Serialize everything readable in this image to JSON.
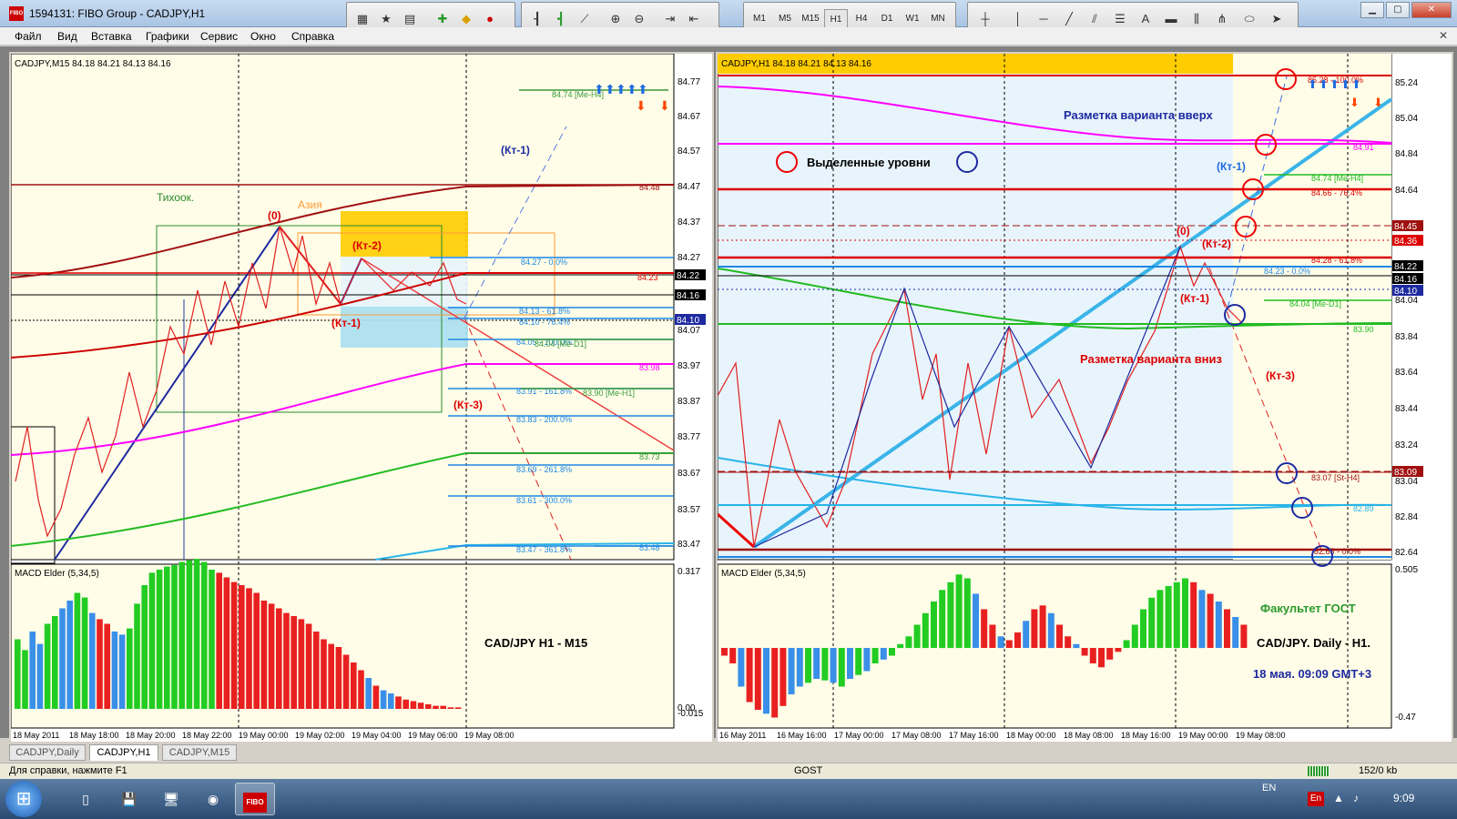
{
  "window": {
    "title": "1594131: FIBO Group - CADJPY,H1",
    "app_icon": "FIBO"
  },
  "toolbars": {
    "timeframes": [
      "M1",
      "M5",
      "M15",
      "H1",
      "H4",
      "D1",
      "W1",
      "MN"
    ],
    "selected_timeframe": "H1"
  },
  "menu": [
    "Файл",
    "Вид",
    "Вставка",
    "Графики",
    "Сервис",
    "Окно",
    "Справка"
  ],
  "left_chart": {
    "header": "CADJPY,M15  84.18 84.21 84.13 84.16",
    "indicator_header": "MACD Elder (5,34,5)",
    "overlay_title": "CAD/JPY H1 - M15",
    "price_axis": [
      "84.77",
      "84.67",
      "84.57",
      "84.47",
      "84.37",
      "84.27",
      "84.16",
      "84.07",
      "83.97",
      "83.87",
      "83.77",
      "83.67",
      "83.57",
      "83.47"
    ],
    "macd_axis": [
      "0.317",
      "0.00",
      "-0.015"
    ],
    "current_prices": [
      "84.22",
      "84.16",
      "84.10"
    ],
    "time_axis": [
      "18 May 2011",
      "18 May 18:00",
      "18 May 20:00",
      "18 May 22:00",
      "19 May 00:00",
      "19 May 02:00",
      "19 May 04:00",
      "19 May 06:00",
      "19 May 08:00"
    ],
    "labels": {
      "tokyo": "Тихоок.",
      "asia": "Азия",
      "k0": "(0)",
      "kt1_blue": "(Кт-1)",
      "kt1_red": "(Кт-1)",
      "kt2": "(Кт-2)",
      "kt3": "(Кт-3)"
    },
    "levels": [
      {
        "label": "84.74 [Me-H4]"
      },
      {
        "label": "84.48"
      },
      {
        "label": "84.27 - 0.0%"
      },
      {
        "label": "84.23"
      },
      {
        "label": "84.13 - 61.8%"
      },
      {
        "label": "84.10 - 76.4%"
      },
      {
        "label": "84.05 - 100.0%"
      },
      {
        "label": "84.04 [Me-D1]"
      },
      {
        "label": "83.98"
      },
      {
        "label": "83.91 - 161.8%"
      },
      {
        "label": "83.90 [Me-H1]"
      },
      {
        "label": "83.83 - 200.0%"
      },
      {
        "label": "83.73"
      },
      {
        "label": "83.69 - 261.8%"
      },
      {
        "label": "83.61 - 300.0%"
      },
      {
        "label": "83.47 - 361.8%"
      },
      {
        "label": "83.48"
      }
    ]
  },
  "right_chart": {
    "header": "CADJPY,H1  84.18 84.21 84.13 84.16",
    "indicator_header": "MACD Elder (5,34,5)",
    "price_axis": [
      "85.24",
      "85.04",
      "84.84",
      "84.64",
      "84.45",
      "84.36",
      "84.22",
      "84.16",
      "84.10",
      "84.04",
      "83.84",
      "83.64",
      "83.44",
      "83.24",
      "83.09",
      "83.04",
      "82.84",
      "82.64"
    ],
    "macd_axis": [
      "0.505",
      "-0.47"
    ],
    "time_axis": [
      "16 May 2011",
      "16 May 16:00",
      "17 May 00:00",
      "17 May 08:00",
      "17 May 16:00",
      "18 May 00:00",
      "18 May 08:00",
      "18 May 16:00",
      "19 May 00:00",
      "19 May 08:00"
    ],
    "labels": {
      "up_variant": "Разметка варианта вверх",
      "down_variant": "Разметка варианта вниз",
      "selected_levels": "Выделенные уровни",
      "k0": "(0)",
      "kt1_blue": "(Кт-1)",
      "kt1_red": "(Кт-1)",
      "kt2": "(Кт-2)",
      "kt3": "(Кт-3)",
      "faculty": "Факультет ГОСТ",
      "pair_tf": "CAD/JPY. Daily - H1.",
      "date": "18 мая. 09:09 GMT+3"
    },
    "levels": [
      {
        "label": "85.28 - 100.0%"
      },
      {
        "label": "84.91"
      },
      {
        "label": "84.74 [Me-H4]"
      },
      {
        "label": "84.66 - 76.4%"
      },
      {
        "label": "84.28 - 61.8%"
      },
      {
        "label": "84.23 - 0.0%"
      },
      {
        "label": "84.04 [Me-D1]"
      },
      {
        "label": "83.90"
      },
      {
        "label": "83.07 [St-H4]"
      },
      {
        "label": "82.89"
      },
      {
        "label": "82.65 - 0.0%"
      }
    ]
  },
  "tabs": [
    "CADJPY,Daily",
    "CADJPY,H1",
    "CADJPY,M15"
  ],
  "active_tab": "CADJPY,H1",
  "status": {
    "help": "Для справки, нажмите F1",
    "profile": "GOST",
    "traffic": "152/0 kb"
  },
  "taskbar": {
    "lang": "EN",
    "time": "9:09"
  },
  "colors": {
    "chart_bg": "#fffde8",
    "up_bar": "#22cc22",
    "down_bar": "#e82020",
    "neutral_bar": "#3a8fe8",
    "fib_blue": "#1e88e5",
    "ma_red": "#cc0000",
    "ma_magenta": "#ff00ff",
    "ma_green": "#22bb22",
    "ma_cyan": "#28b4e8"
  }
}
